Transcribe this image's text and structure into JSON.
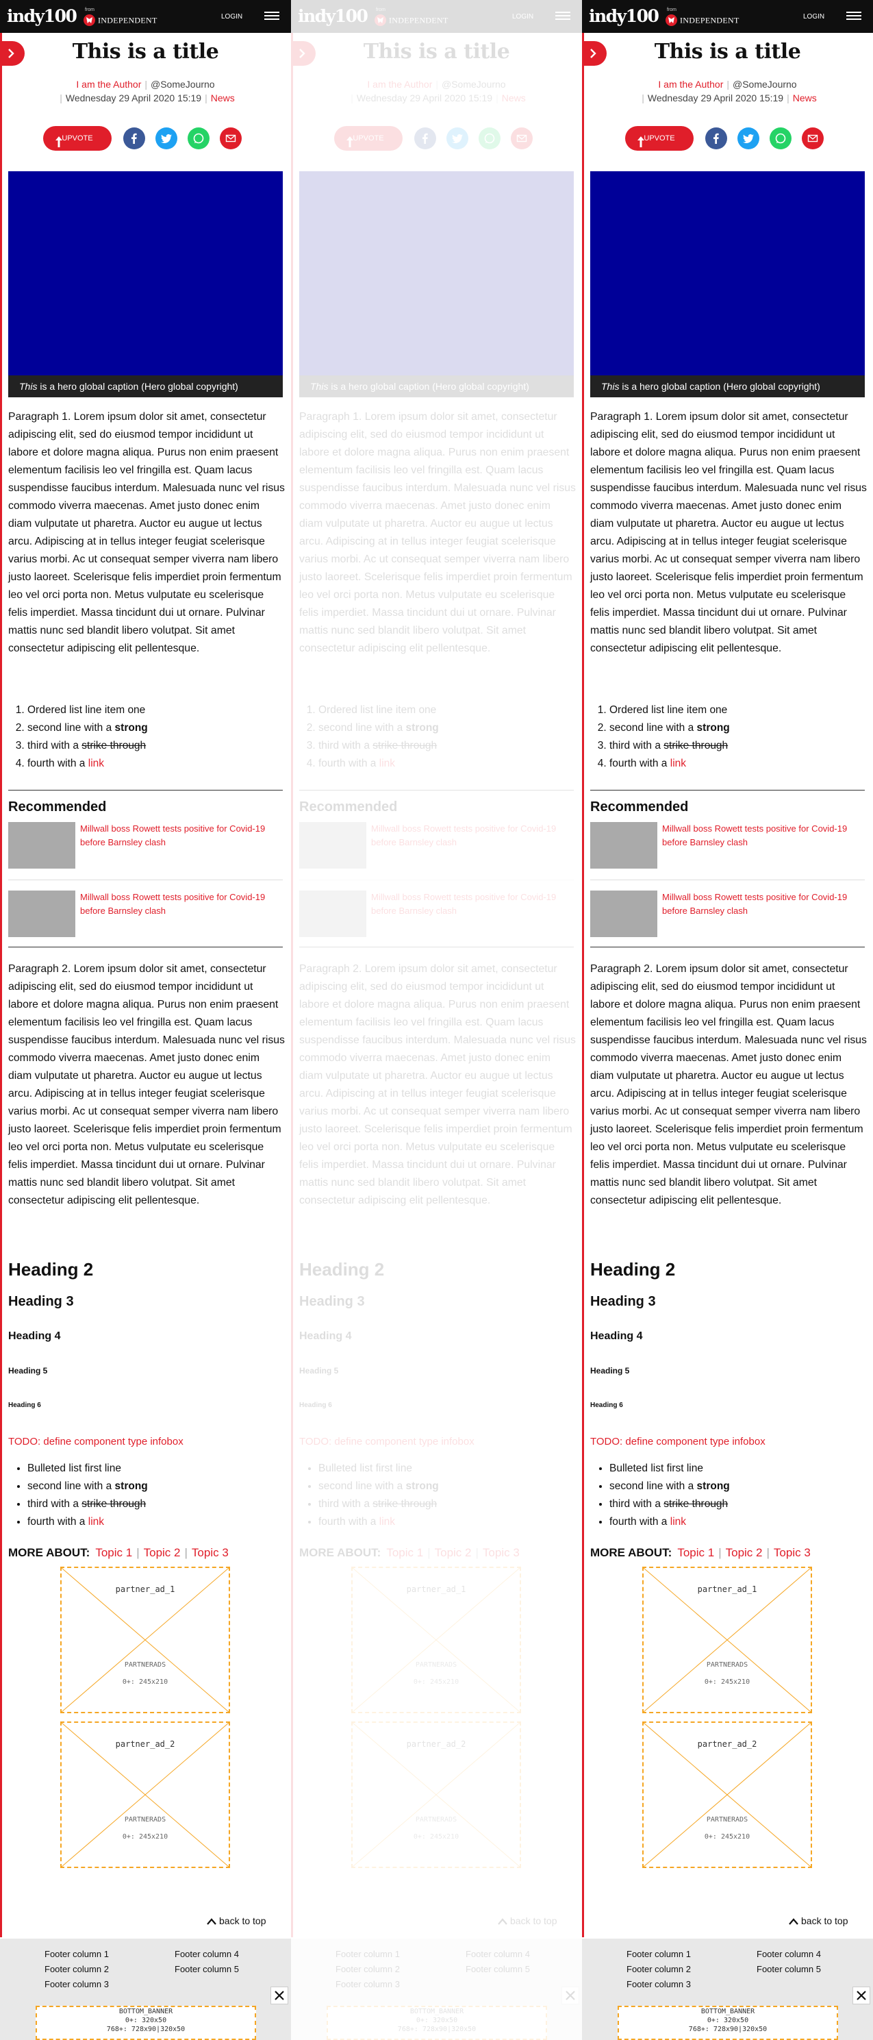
{
  "header": {
    "logo": "indy100",
    "from": "from",
    "brand": "INDEPENDENT",
    "login": "LOGIN"
  },
  "article": {
    "title": "This is a title",
    "author": "I am the Author",
    "handle": "@SomeJourno",
    "date": "Wednesday 29 April 2020 15:19",
    "section": "News",
    "upvote": "UPVOTE",
    "caption_em": "This",
    "caption_rest": " is a hero global caption (Hero global copyright)",
    "para1": "Paragraph 1. Lorem ipsum dolor sit amet, consectetur adipiscing elit, sed do eiusmod tempor incididunt ut labore et dolore magna aliqua. Purus non enim praesent elementum facilisis leo vel fringilla est. Quam lacus suspendisse faucibus interdum. Malesuada nunc vel risus commodo viverra maecenas. Amet justo donec enim diam vulputate ut pharetra. Auctor eu augue ut lectus arcu. Adipiscing at in tellus integer feugiat scelerisque varius morbi. Ac ut consequat semper viverra nam libero justo laoreet. Scelerisque felis imperdiet proin fermentum leo vel orci porta non. Metus vulputate eu scelerisque felis imperdiet. Massa tincidunt dui ut ornare. Pulvinar mattis nunc sed blandit libero volutpat. Sit amet consectetur adipiscing elit pellentesque.",
    "para2": "Paragraph 2. Lorem ipsum dolor sit amet, consectetur adipiscing elit, sed do eiusmod tempor incididunt ut labore et dolore magna aliqua. Purus non enim praesent elementum facilisis leo vel fringilla est. Quam lacus suspendisse faucibus interdum. Malesuada nunc vel risus commodo viverra maecenas. Amet justo donec enim diam vulputate ut pharetra. Auctor eu augue ut lectus arcu. Adipiscing at in tellus integer feugiat scelerisque varius morbi. Ac ut consequat semper viverra nam libero justo laoreet. Scelerisque felis imperdiet proin fermentum leo vel orci porta non. Metus vulputate eu scelerisque felis imperdiet. Massa tincidunt dui ut ornare. Pulvinar mattis nunc sed blandit libero volutpat. Sit amet consectetur adipiscing elit pellentesque.",
    "ordered": [
      {
        "pre": "Ordered list line item one"
      },
      {
        "pre": "second line with a ",
        "strong": "strong"
      },
      {
        "pre": "third with a ",
        "strike": "strike through"
      },
      {
        "pre": "fourth with a ",
        "link": "link"
      }
    ],
    "recommended_title": "Recommended",
    "recommended": [
      "Millwall boss Rowett tests positive for Covid-19 before Barnsley clash",
      "Millwall boss Rowett tests positive for Covid-19 before Barnsley clash"
    ],
    "h2": "Heading 2",
    "h3": "Heading 3",
    "h4": "Heading 4",
    "h5": "Heading 5",
    "h6": "Heading 6",
    "todo": "TODO: define component type infobox",
    "bullets": [
      {
        "pre": "Bulleted list first line"
      },
      {
        "pre": "second line with a ",
        "strong": "strong"
      },
      {
        "pre": "third with a ",
        "strike": "strike through"
      },
      {
        "pre": "fourth with a ",
        "link": "link"
      }
    ],
    "more_about": "MORE ABOUT:",
    "topics": [
      "Topic 1",
      "Topic 2",
      "Topic 3"
    ],
    "ads": [
      {
        "name": "partner_ad_1",
        "sub": "PARTNERADS",
        "size": "0+: 245x210"
      },
      {
        "name": "partner_ad_2",
        "sub": "PARTNERADS",
        "size": "0+: 245x210"
      }
    ],
    "back_to_top": "back to top"
  },
  "footer": {
    "columns": [
      "Footer column 1",
      "Footer column 2",
      "Footer column 3",
      "Footer column 4",
      "Footer column 5"
    ],
    "banner": [
      "BOTTOM_BANNER",
      "0+: 320x50",
      "768+: 728x90|320x50"
    ]
  },
  "colors": {
    "accent": "#e01e2a",
    "hero": "#000098",
    "header": "#0f0f0f",
    "ad_border": "#f5a623"
  }
}
